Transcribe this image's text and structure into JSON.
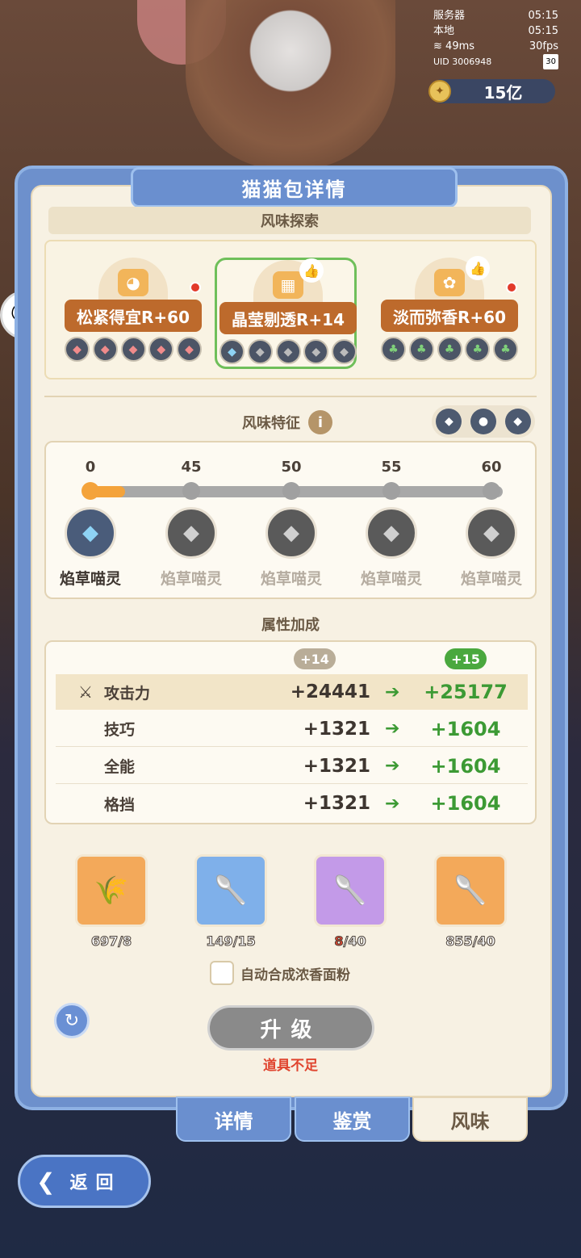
{
  "hud": {
    "server_label": "服务器",
    "server_time": "05:15",
    "local_label": "本地",
    "local_time": "05:15",
    "ping": "49ms",
    "fps": "30fps",
    "uid": "UID 3006948",
    "battery": "30"
  },
  "currency": {
    "value": "15亿",
    "icon": "coin-icon"
  },
  "title": "猫猫包详情",
  "section_flavor": "风味探索",
  "flavors": [
    {
      "label": "松紧得宜R+60",
      "icon": "cat-face-icon",
      "color": "#f2b55a"
    },
    {
      "label": "晶莹剔透R+14",
      "icon": "box-icon",
      "color": "#f2b55a"
    },
    {
      "label": "淡而弥香R+60",
      "icon": "fox-icon",
      "color": "#f2b55a"
    }
  ],
  "feature_title": "风味特征",
  "track": {
    "levels": [
      "0",
      "45",
      "50",
      "55",
      "60"
    ],
    "progress": 0.1,
    "names": [
      "焰草喵灵",
      "焰草喵灵",
      "焰草喵灵",
      "焰草喵灵",
      "焰草喵灵"
    ]
  },
  "attr_title": "属性加成",
  "attr_badges": {
    "current": "+14",
    "next": "+15"
  },
  "attrs": [
    {
      "name": "攻击力",
      "cur": "+24441",
      "next": "+25177"
    },
    {
      "name": "技巧",
      "cur": "+1321",
      "next": "+1604"
    },
    {
      "name": "全能",
      "cur": "+1321",
      "next": "+1604"
    },
    {
      "name": "格挡",
      "cur": "+1321",
      "next": "+1604"
    }
  ],
  "items": [
    {
      "count": "697/8",
      "icon": "flour-bag-icon"
    },
    {
      "count": "149/15",
      "icon": "wooden-spoon-icon"
    },
    {
      "count_have": "8",
      "count_need": "/40",
      "icon": "cat-spoon-icon"
    },
    {
      "count": "855/40",
      "icon": "bunny-spoon-icon"
    }
  ],
  "auto_label": "自动合成浓香面粉",
  "upgrade_label": "升级",
  "warning": "道具不足",
  "tabs": [
    "详情",
    "鉴赏",
    "风味"
  ],
  "back_label": "返回",
  "colors": {
    "accent": "#6a8fcf",
    "selected": "#6fbf5a",
    "warn": "#e0442e",
    "green": "#3c9a34"
  }
}
